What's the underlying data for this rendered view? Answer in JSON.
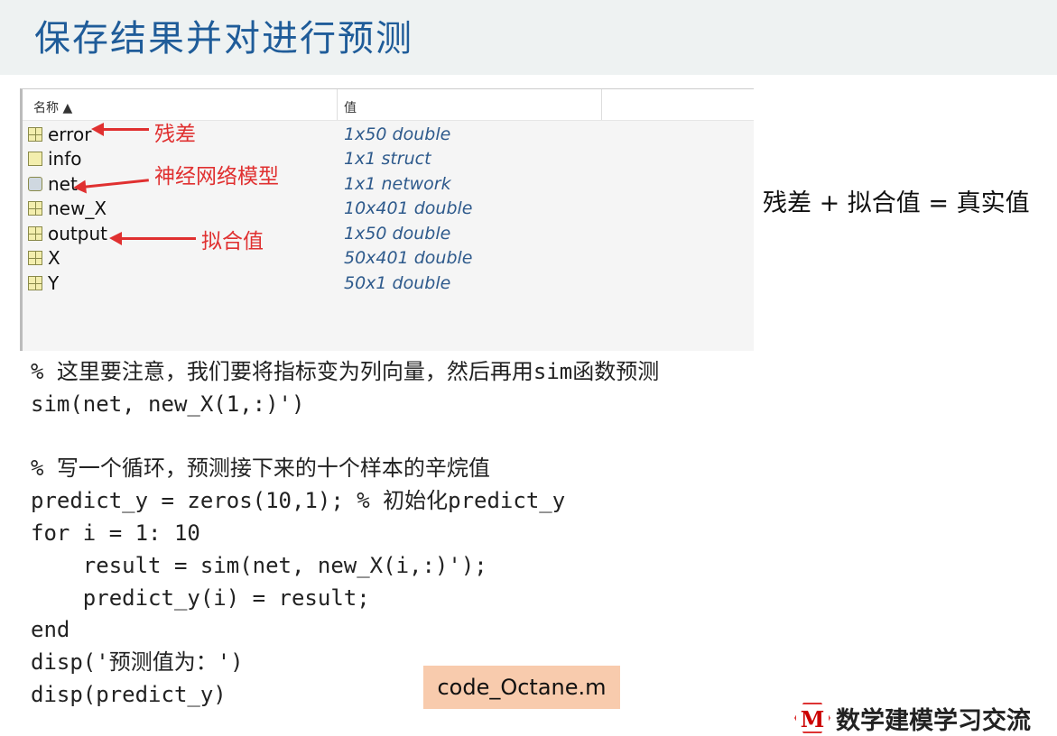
{
  "title": "保存结果并对进行预测",
  "workspace": {
    "headers": [
      "名称 ▲",
      "值"
    ],
    "rows": [
      {
        "name": "error",
        "value": "1x50 double",
        "icon": "matrix-icon"
      },
      {
        "name": "info",
        "value": "1x1 struct",
        "icon": "struct-icon"
      },
      {
        "name": "net",
        "value": "1x1 network",
        "icon": "network-icon"
      },
      {
        "name": "new_X",
        "value": "10x401 double",
        "icon": "matrix-icon"
      },
      {
        "name": "output",
        "value": "1x50 double",
        "icon": "matrix-icon"
      },
      {
        "name": "X",
        "value": "50x401 double",
        "icon": "matrix-icon"
      },
      {
        "name": "Y",
        "value": "50x1 double",
        "icon": "matrix-icon"
      }
    ],
    "annotations": {
      "error": "残差",
      "net": "神经网络模型",
      "output": "拟合值"
    }
  },
  "equation": "残差 + 拟合值 = 真实值",
  "code": "% 这里要注意，我们要将指标变为列向量，然后再用sim函数预测\nsim(net, new_X(1,:)')\n\n% 写一个循环，预测接下来的十个样本的辛烷值\npredict_y = zeros(10,1); % 初始化predict_y\nfor i = 1: 10\n    result = sim(net, new_X(i,:)');\n    predict_y(i) = result;\nend\ndisp('预测值为：')\ndisp(predict_y)",
  "file_label": "code_Octane.m",
  "logo": {
    "letter": "M",
    "text": "数学建模学习交流"
  },
  "colors": {
    "title": "#1f5c99",
    "annotation": "#e03030",
    "file_bg": "#f8cbad"
  }
}
